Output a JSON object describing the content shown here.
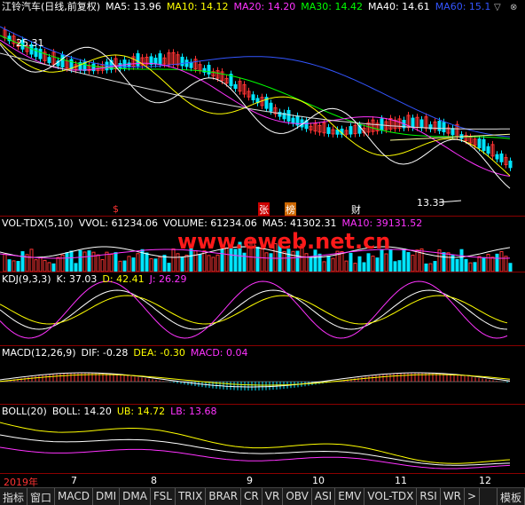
{
  "main": {
    "title": "江铃汽车(日线,前复权)",
    "ma": [
      {
        "label": "MA5: 13.96",
        "color": "#ffffff"
      },
      {
        "label": "MA10: 14.12",
        "color": "#ffff00"
      },
      {
        "label": "MA20: 14.20",
        "color": "#ff33ff"
      },
      {
        "label": "MA30: 14.42",
        "color": "#00ff00"
      },
      {
        "label": "MA40: 14.61",
        "color": "#ffffff"
      },
      {
        "label": "MA60: 15.1",
        "color": "#3355ff"
      }
    ],
    "high_label": "25.31",
    "low_label": "13.33",
    "markers": [
      {
        "text": "$",
        "color": "#ff3333"
      },
      {
        "text": "张",
        "color": "#ffffff",
        "bg": "#cc0000"
      },
      {
        "text": "榜",
        "color": "#ffffff",
        "bg": "#cc6600"
      },
      {
        "text": "财",
        "color": "#ffffff"
      }
    ]
  },
  "vol": {
    "title": "VOL-TDX(5,10)",
    "fields": [
      {
        "label": "VVOL: 61234.06",
        "color": "#ffffff"
      },
      {
        "label": "VOLUME: 61234.06",
        "color": "#ffffff"
      },
      {
        "label": "MA5: 41302.31",
        "color": "#ffffff"
      },
      {
        "label": "MA10: 39131.52",
        "color": "#ff33ff"
      }
    ],
    "watermark": "www.eweb.net.cn"
  },
  "kdj": {
    "title": "KDJ(9,3,3)",
    "fields": [
      {
        "label": "K: 37.03",
        "color": "#ffffff"
      },
      {
        "label": "D: 42.41",
        "color": "#ffff00"
      },
      {
        "label": "J: 26.29",
        "color": "#ff33ff"
      }
    ]
  },
  "macd": {
    "title": "MACD(12,26,9)",
    "fields": [
      {
        "label": "DIF: -0.28",
        "color": "#ffffff"
      },
      {
        "label": "DEA: -0.30",
        "color": "#ffff00"
      },
      {
        "label": "MACD: 0.04",
        "color": "#ff33ff"
      }
    ]
  },
  "boll": {
    "title": "BOLL(20)",
    "fields": [
      {
        "label": "BOLL: 14.20",
        "color": "#ffffff"
      },
      {
        "label": "UB: 14.72",
        "color": "#ffff00"
      },
      {
        "label": "LB: 13.68",
        "color": "#ff33ff"
      }
    ]
  },
  "xaxis": {
    "labels": [
      "2019年",
      "7",
      "8",
      "9",
      "10",
      "11",
      "12"
    ]
  },
  "toolbar": {
    "items": [
      "指标",
      "窗口",
      "MACD",
      "DMI",
      "DMA",
      "FSL",
      "TRIX",
      "BRAR",
      "CR",
      "VR",
      "OBV",
      "ASI",
      "EMV",
      "VOL-TDX",
      "RSI",
      "WR",
      ">",
      "模板"
    ]
  }
}
